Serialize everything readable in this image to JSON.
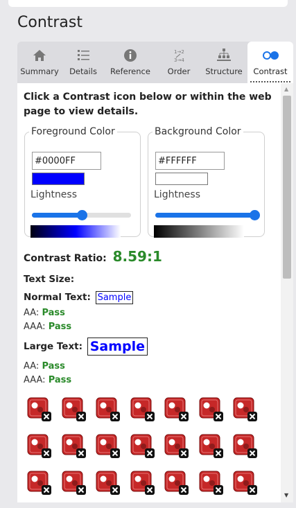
{
  "panel": {
    "title": "Contrast"
  },
  "tabs": [
    {
      "label": "Summary",
      "icon": "home-icon"
    },
    {
      "label": "Details",
      "icon": "list-icon"
    },
    {
      "label": "Reference",
      "icon": "info-icon"
    },
    {
      "label": "Order",
      "icon": "order-icon"
    },
    {
      "label": "Structure",
      "icon": "structure-icon"
    },
    {
      "label": "Contrast",
      "icon": "contrast-icon",
      "active": true
    }
  ],
  "instruction": "Click a Contrast icon below or within the web page to view details.",
  "foreground": {
    "legend": "Foreground Color",
    "hex": "#0000FF",
    "swatch_color": "#0000FF",
    "lightness_label": "Lightness",
    "lightness_fraction": 0.5
  },
  "background": {
    "legend": "Background Color",
    "hex": "#FFFFFF",
    "swatch_color": "#FFFFFF",
    "lightness_label": "Lightness",
    "lightness_fraction": 1.0
  },
  "contrast": {
    "ratio_label": "Contrast Ratio:",
    "ratio_value": "8.59:1",
    "text_size_label": "Text Size:",
    "normal_label": "Normal Text:",
    "normal_sample": "Sample",
    "normal_aa_label": "AA:",
    "normal_aa": "Pass",
    "normal_aaa_label": "AAA:",
    "normal_aaa": "Pass",
    "large_label": "Large Text:",
    "large_sample": "Sample",
    "large_aa_label": "AA:",
    "large_aa": "Pass",
    "large_aaa_label": "AAA:",
    "large_aaa": "Pass"
  },
  "contrast_icons": {
    "rows": 3,
    "per_row": 7,
    "icon": "contrast-error-icon",
    "color": "#c62828"
  },
  "colors": {
    "pass": "#2a8a2a",
    "accent": "#1a73e8"
  }
}
